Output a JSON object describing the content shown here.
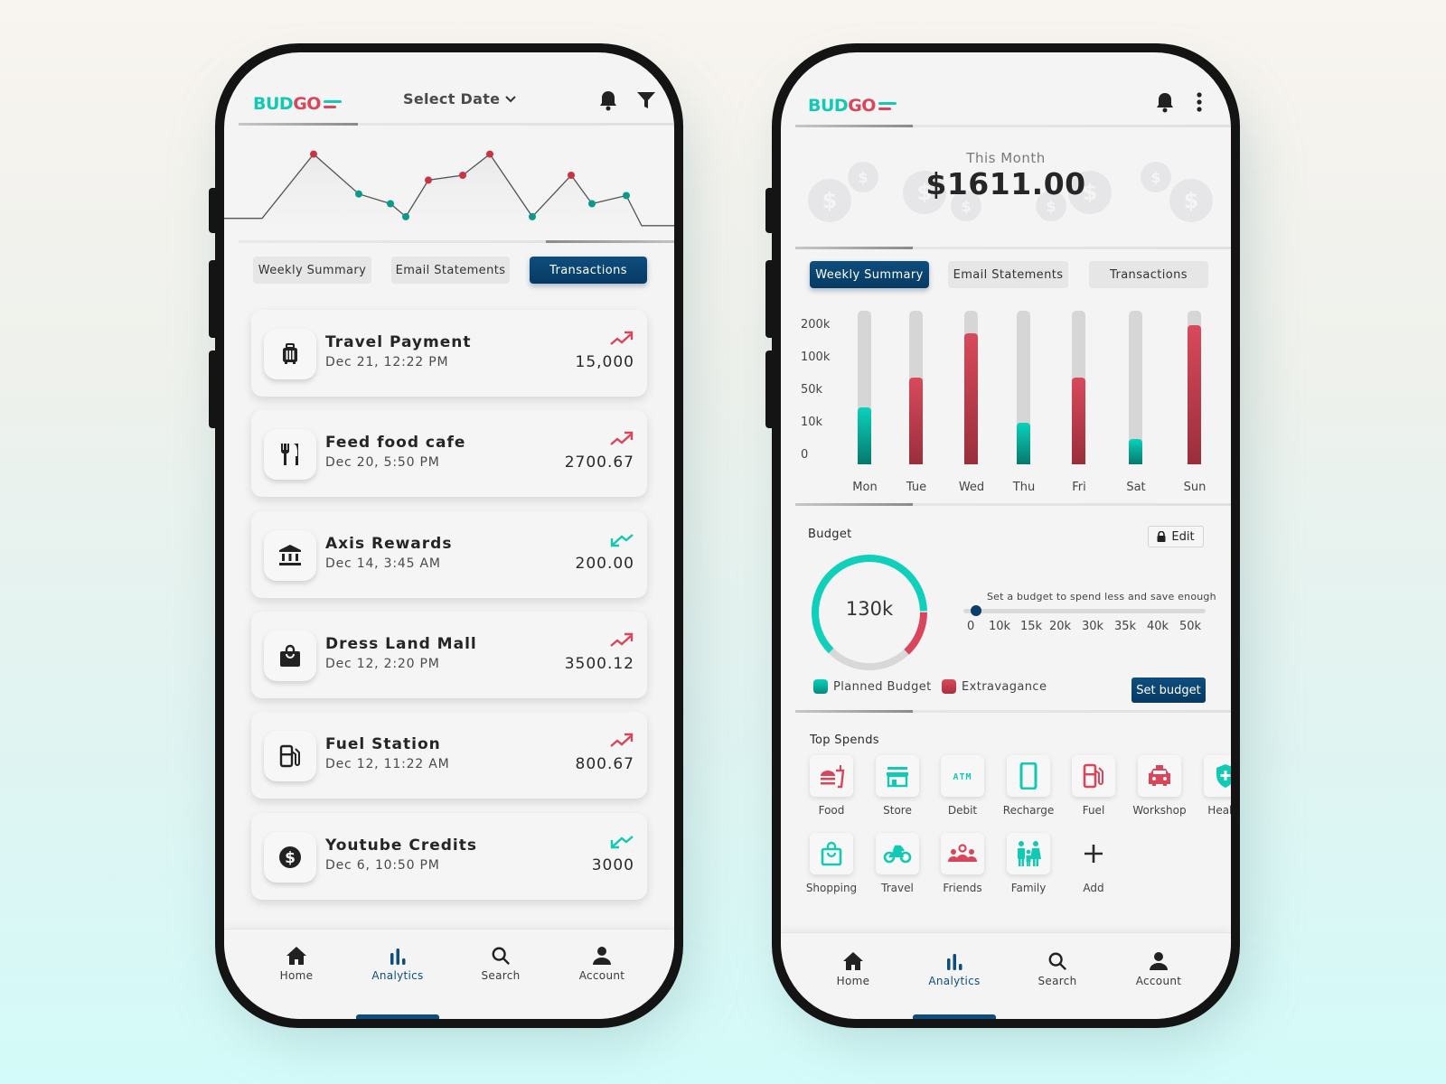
{
  "brand": {
    "part1": "BUD",
    "part2": "GO",
    "color_teal": "#12c9b3",
    "color_red": "#d9455a",
    "color_navy": "#0e4e7e"
  },
  "left_phone": {
    "header": {
      "date_select_label": "Select Date",
      "icons": [
        "bell-icon",
        "filter-icon"
      ]
    },
    "trend_chart": {
      "type": "line",
      "values": [
        17,
        17,
        96,
        47,
        35,
        19,
        64,
        70,
        96,
        19,
        70,
        35,
        45,
        8,
        8
      ],
      "point_colors": [
        null,
        null,
        "red",
        "teal",
        "teal",
        "teal",
        "red",
        "red",
        "red",
        "teal",
        "red",
        "teal",
        "teal",
        null,
        null
      ]
    },
    "tabs": [
      {
        "label": "Weekly Summary",
        "active": false
      },
      {
        "label": "Email Statements",
        "active": false
      },
      {
        "label": "Transactions",
        "active": true
      }
    ],
    "transactions": [
      {
        "name": "Travel Payment",
        "date": "Dec 21, 12:22 PM",
        "amount": "15,000",
        "trend": "up",
        "icon": "luggage-icon"
      },
      {
        "name": "Feed food cafe",
        "date": "Dec 20, 5:50 PM",
        "amount": "2700.67",
        "trend": "up",
        "icon": "utensils-icon"
      },
      {
        "name": "Axis Rewards",
        "date": "Dec 14, 3:45 AM",
        "amount": "200.00",
        "trend": "down",
        "icon": "bank-icon"
      },
      {
        "name": "Dress Land Mall",
        "date": "Dec 12, 2:20 PM",
        "amount": "3500.12",
        "trend": "up",
        "icon": "shopping-bag-icon"
      },
      {
        "name": "Fuel Station",
        "date": "Dec 12, 11:22 AM",
        "amount": "800.67",
        "trend": "up",
        "icon": "fuel-pump-icon"
      },
      {
        "name": "Youtube Credits",
        "date": "Dec 6, 10:50 PM",
        "amount": "3000",
        "trend": "down",
        "icon": "dollar-coin-icon"
      }
    ],
    "nav": [
      {
        "label": "Home",
        "icon": "home-icon",
        "active": false
      },
      {
        "label": "Analytics",
        "icon": "analytics-icon",
        "active": true
      },
      {
        "label": "Search",
        "icon": "search-icon",
        "active": false
      },
      {
        "label": "Account",
        "icon": "account-icon",
        "active": false
      }
    ]
  },
  "right_phone": {
    "header": {
      "icons": [
        "bell-icon",
        "more-vertical-icon"
      ]
    },
    "summary": {
      "label": "This Month",
      "amount": "$1611.00"
    },
    "tabs": [
      {
        "label": "Weekly Summary",
        "active": true
      },
      {
        "label": "Email Statements",
        "active": false
      },
      {
        "label": "Transactions",
        "active": false
      }
    ],
    "budget": {
      "title": "Budget",
      "edit_label": "Edit",
      "donut_center": "130k",
      "planned_fraction": 0.62,
      "extravagance_fraction": 0.13,
      "slider_hint": "Set a budget to spend less and save enough",
      "slider_labels": [
        "0",
        "10k",
        "15k",
        "20k",
        "30k",
        "35k",
        "40k",
        "50k"
      ],
      "slider_value": "0",
      "legend": [
        {
          "label": "Planned Budget",
          "color": "#0ab8a4"
        },
        {
          "label": "Extravagance",
          "color": "#c23e4f"
        }
      ],
      "set_budget_label": "Set budget"
    },
    "top_spends": {
      "title": "Top Spends",
      "items": [
        {
          "label": "Food",
          "icon": "burger-drink-icon",
          "color": "#d9455a"
        },
        {
          "label": "Store",
          "icon": "store-icon",
          "color": "#12c9b3"
        },
        {
          "label": "Debit",
          "icon": "atm-icon",
          "color": "#12c9b3"
        },
        {
          "label": "Recharge",
          "icon": "mobile-phone-icon",
          "color": "#12c9b3"
        },
        {
          "label": "Fuel",
          "icon": "fuel-pump-icon",
          "color": "#d9455a"
        },
        {
          "label": "Workshop",
          "icon": "car-icon",
          "color": "#d9455a"
        },
        {
          "label": "Health",
          "icon": "shield-plus-icon",
          "color": "#12c9b3"
        },
        {
          "label": "Shopping",
          "icon": "shopping-bag-icon",
          "color": "#12c9b3"
        },
        {
          "label": "Travel",
          "icon": "motorcycle-icon",
          "color": "#12c9b3"
        },
        {
          "label": "Friends",
          "icon": "group-icon",
          "color": "#d9455a"
        },
        {
          "label": "Family",
          "icon": "family-icon",
          "color": "#12c9b3"
        },
        {
          "label": "Add",
          "icon": "plus-icon",
          "color": "#2a2a2a"
        }
      ]
    },
    "nav": [
      {
        "label": "Home",
        "icon": "home-icon",
        "active": false
      },
      {
        "label": "Analytics",
        "icon": "analytics-icon",
        "active": true
      },
      {
        "label": "Search",
        "icon": "search-icon",
        "active": false
      },
      {
        "label": "Account",
        "icon": "account-icon",
        "active": false
      }
    ]
  },
  "chart_data": [
    {
      "type": "bar",
      "title": "Weekly Summary",
      "categories": [
        "Mon",
        "Tue",
        "Wed",
        "Thu",
        "Fri",
        "Sat",
        "Sun"
      ],
      "values": [
        29000,
        70000,
        176000,
        10000,
        70000,
        5000,
        200000
      ],
      "bar_colors": [
        "teal",
        "red",
        "red",
        "teal",
        "red",
        "teal",
        "red"
      ],
      "yticks": [
        "200k",
        "100k",
        "50k",
        "10k",
        "0"
      ],
      "ytick_values": [
        200000,
        100000,
        50000,
        10000,
        0
      ],
      "ylim": [
        0,
        200000
      ],
      "xlabel": "",
      "ylabel": ""
    },
    {
      "type": "pie",
      "title": "Budget",
      "center_label": "130k",
      "series": [
        {
          "name": "Planned Budget",
          "value": 62
        },
        {
          "name": "Extravagance",
          "value": 13
        },
        {
          "name": "Remaining",
          "value": 25
        }
      ]
    }
  ]
}
